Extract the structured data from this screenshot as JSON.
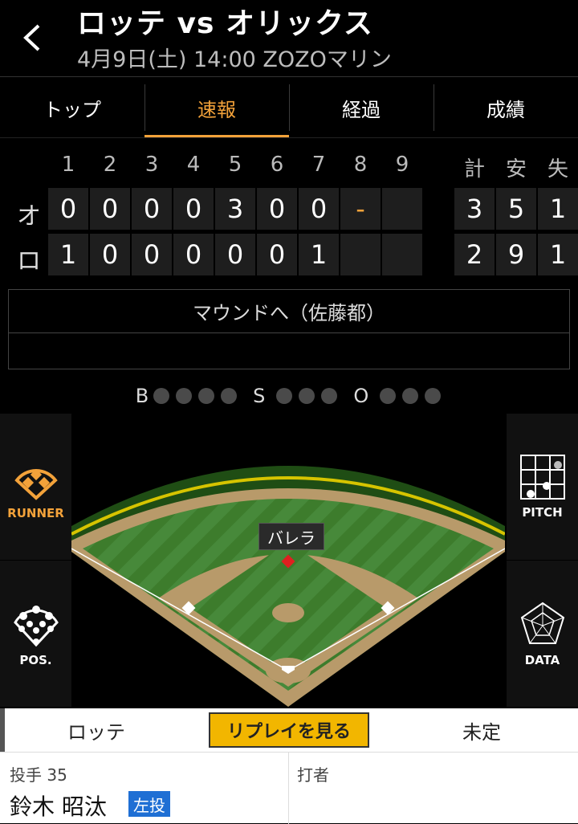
{
  "header": {
    "title": "ロッテ vs オリックス",
    "subtitle": "4月9日(土) 14:00 ZOZOマリン"
  },
  "tabs": [
    {
      "label": "トップ",
      "active": false
    },
    {
      "label": "速報",
      "active": true
    },
    {
      "label": "経過",
      "active": false
    },
    {
      "label": "成績",
      "active": false
    }
  ],
  "scoreboard": {
    "innings": [
      "1",
      "2",
      "3",
      "4",
      "5",
      "6",
      "7",
      "8",
      "9"
    ],
    "totals_headers": [
      "計",
      "安",
      "失"
    ],
    "teams": [
      {
        "abbr": "オ",
        "scores": [
          "0",
          "0",
          "0",
          "0",
          "3",
          "0",
          "0",
          "-",
          ""
        ],
        "totals": [
          "3",
          "5",
          "1"
        ]
      },
      {
        "abbr": "ロ",
        "scores": [
          "1",
          "0",
          "0",
          "0",
          "0",
          "0",
          "1",
          "",
          ""
        ],
        "totals": [
          "2",
          "9",
          "1"
        ]
      }
    ]
  },
  "play": {
    "text": "マウンドへ（佐藤都）"
  },
  "count": {
    "balls_label": "B",
    "strikes_label": "S",
    "outs_label": "O"
  },
  "side_buttons": {
    "runner": "RUNNER",
    "pos": "POS.",
    "pitch": "PITCH",
    "data": "DATA"
  },
  "field": {
    "batter_name": "バレラ"
  },
  "bottom_tabs": {
    "left": "ロッテ",
    "replay": "リプレイを見る",
    "right": "未定"
  },
  "pitcher": {
    "label": "投手 35",
    "name": "鈴木 昭汰",
    "badge": "左投"
  },
  "batter": {
    "label": "打者"
  },
  "colors": {
    "accent": "#f3a23a",
    "replay": "#f2b600",
    "badge": "#1f6fd4",
    "grass": "#3c7d2e"
  }
}
